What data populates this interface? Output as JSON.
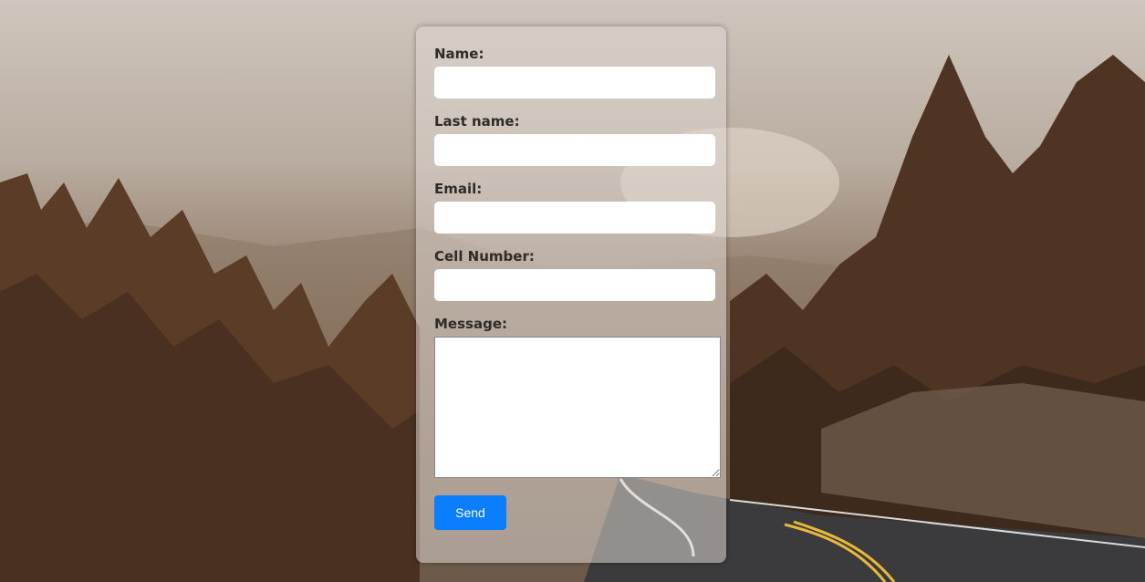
{
  "form": {
    "name_label": "Name:",
    "name_value": "",
    "lastname_label": "Last name:",
    "lastname_value": "",
    "email_label": "Email:",
    "email_value": "",
    "cell_label": "Cell Number:",
    "cell_value": "",
    "message_label": "Message:",
    "message_value": "",
    "send_label": "Send"
  },
  "colors": {
    "send_button": "#0b7dff",
    "card_background": "rgba(220,214,208,0.55)",
    "label_text": "#2f2b28"
  }
}
